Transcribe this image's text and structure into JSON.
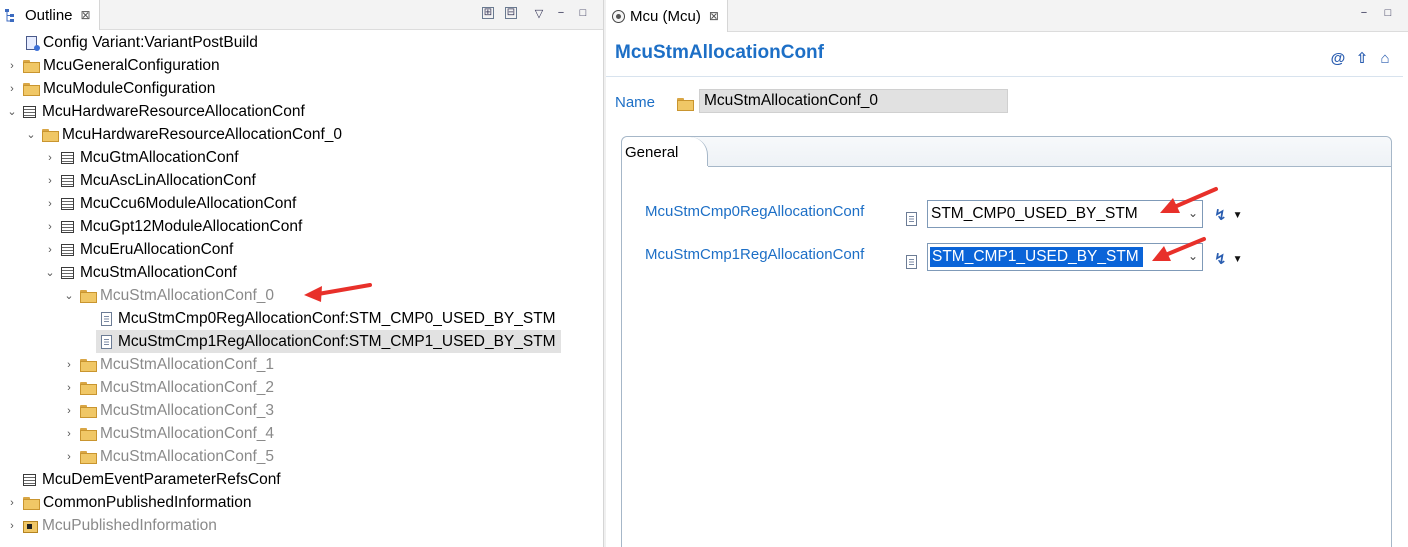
{
  "outline": {
    "tab_title": "Outline",
    "tab_close": "⊠",
    "toolbar": {
      "expand": "⊞",
      "collapse": "⊟",
      "menu": "▽",
      "minimize": "−",
      "maximize": "□"
    },
    "tree": [
      {
        "label": "Config Variant:VariantPostBuild",
        "icon": "config-icon"
      },
      {
        "label": "McuGeneralConfiguration",
        "icon": "folder-icon"
      },
      {
        "label": "McuModuleConfiguration",
        "icon": "folder-icon"
      },
      {
        "label": "McuHardwareResourceAllocationConf",
        "icon": "table-icon"
      },
      {
        "label": "McuHardwareResourceAllocationConf_0",
        "icon": "folder-icon"
      },
      {
        "label": "McuGtmAllocationConf",
        "icon": "table-icon"
      },
      {
        "label": "McuAscLinAllocationConf",
        "icon": "table-icon"
      },
      {
        "label": "McuCcu6ModuleAllocationConf",
        "icon": "table-icon"
      },
      {
        "label": "McuGpt12ModuleAllocationConf",
        "icon": "table-icon"
      },
      {
        "label": "McuEruAllocationConf",
        "icon": "table-icon"
      },
      {
        "label": "McuStmAllocationConf",
        "icon": "table-icon"
      },
      {
        "label": "McuStmAllocationConf_0",
        "icon": "folder-icon"
      },
      {
        "label": "McuStmCmp0RegAllocationConf:STM_CMP0_USED_BY_STM",
        "icon": "document-icon"
      },
      {
        "label": "McuStmCmp1RegAllocationConf:STM_CMP1_USED_BY_STM",
        "icon": "document-icon"
      },
      {
        "label": "McuStmAllocationConf_1",
        "icon": "folder-icon"
      },
      {
        "label": "McuStmAllocationConf_2",
        "icon": "folder-icon"
      },
      {
        "label": "McuStmAllocationConf_3",
        "icon": "folder-icon"
      },
      {
        "label": "McuStmAllocationConf_4",
        "icon": "folder-icon"
      },
      {
        "label": "McuStmAllocationConf_5",
        "icon": "folder-icon"
      },
      {
        "label": "McuDemEventParameterRefsConf",
        "icon": "table-icon"
      },
      {
        "label": "CommonPublishedInformation",
        "icon": "folder-icon"
      },
      {
        "label": "McuPublishedInformation",
        "icon": "published-icon"
      }
    ]
  },
  "editor": {
    "tab_title": "Mcu (Mcu)",
    "tab_close": "⊠",
    "title": "McuStmAllocationConf",
    "header_icons": {
      "at": "@",
      "up": "⇧",
      "home": "⌂"
    },
    "name_label": "Name",
    "name_value": "McuStmAllocationConf_0",
    "section_tab": "General",
    "params": [
      {
        "label": "McuStmCmp0RegAllocationConf",
        "value": "STM_CMP0_USED_BY_STM"
      },
      {
        "label": "McuStmCmp1RegAllocationConf",
        "value": "STM_CMP1_USED_BY_STM"
      }
    ],
    "action_glyph": "↯",
    "action_dropdown": "▼",
    "combo_arrow": "⌄"
  },
  "colors": {
    "accent": "#1d6fc6",
    "selection": "#0a64d8",
    "annotation": "#e8302a"
  }
}
